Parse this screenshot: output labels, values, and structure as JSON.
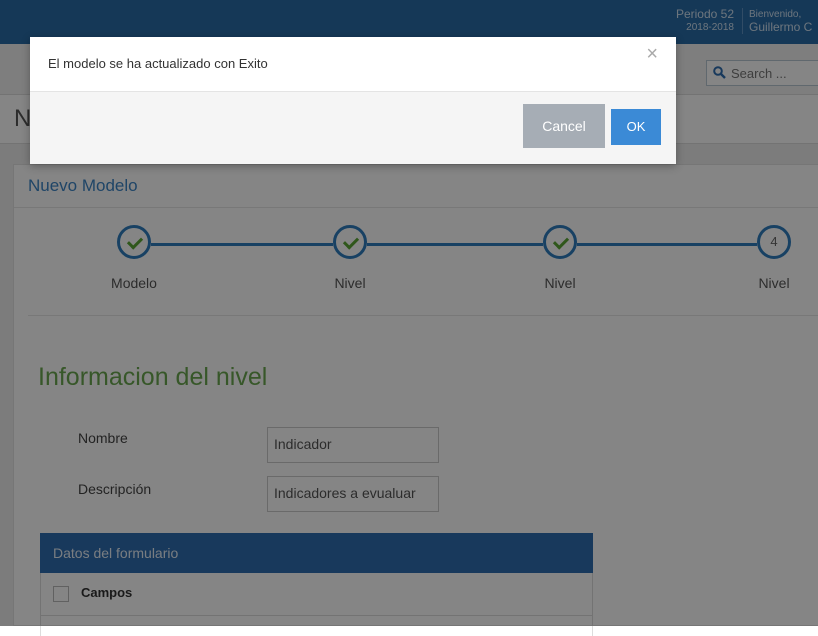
{
  "header": {
    "periodo_title": "Periodo 52",
    "periodo_range": "2018-2018",
    "welcome": "Bienvenido,",
    "user_name": "Guillermo C"
  },
  "search": {
    "placeholder": "Search ..."
  },
  "page": {
    "title_partial": "N"
  },
  "panel": {
    "title": "Nuevo Modelo"
  },
  "steps": [
    {
      "label": "Modelo",
      "state": "done"
    },
    {
      "label": "Nivel",
      "state": "done"
    },
    {
      "label": "Nivel",
      "state": "done"
    },
    {
      "label": "Nivel",
      "state": "current",
      "number": "4"
    }
  ],
  "section": {
    "title": "Informacion del nivel"
  },
  "form": {
    "nombre_label": "Nombre",
    "nombre_value": "Indicador",
    "descripcion_label": "Descripción",
    "descripcion_value": "Indicadores a evualuar"
  },
  "table": {
    "header": "Datos del formulario",
    "column": "Campos"
  },
  "modal": {
    "message": "El modelo se ha actualizado con Exito",
    "close": "×",
    "cancel": "Cancel",
    "ok": "OK"
  },
  "colors": {
    "accent": "#2f7dbf",
    "success": "#5aa834",
    "section_title": "#6aa84f"
  }
}
